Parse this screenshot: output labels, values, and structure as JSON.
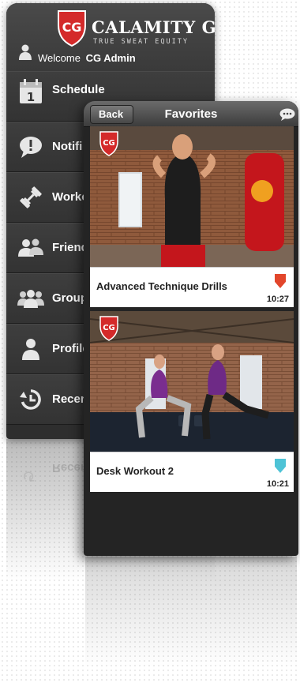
{
  "app": {
    "brand": "CALAMITY GYM",
    "tagline": "TRUE SWEAT EQUITY",
    "welcome_label": "Welcome",
    "user_name": "CG Admin",
    "brand_color": "#d42a2a"
  },
  "menu": {
    "calendar_day": "1",
    "items": [
      {
        "label": "Schedule",
        "icon": "calendar-icon"
      },
      {
        "label": "Notifi",
        "icon": "speech-bubble-icon"
      },
      {
        "label": "Worko",
        "icon": "dumbbell-icon"
      },
      {
        "label": "Friend",
        "icon": "two-people-icon"
      },
      {
        "label": "Group",
        "icon": "group-icon"
      },
      {
        "label": "Profile",
        "icon": "person-icon"
      },
      {
        "label": "Recen",
        "icon": "history-icon"
      }
    ],
    "reflection_label": "Recen"
  },
  "favorites": {
    "back_label": "Back",
    "title": "Favorites",
    "videos": [
      {
        "title": "Advanced Technique Drills",
        "duration": "10:27",
        "tag_color": "#e2462b"
      },
      {
        "title": "Desk Workout 2",
        "duration": "10:21",
        "tag_color": "#4ec3d6"
      }
    ]
  }
}
